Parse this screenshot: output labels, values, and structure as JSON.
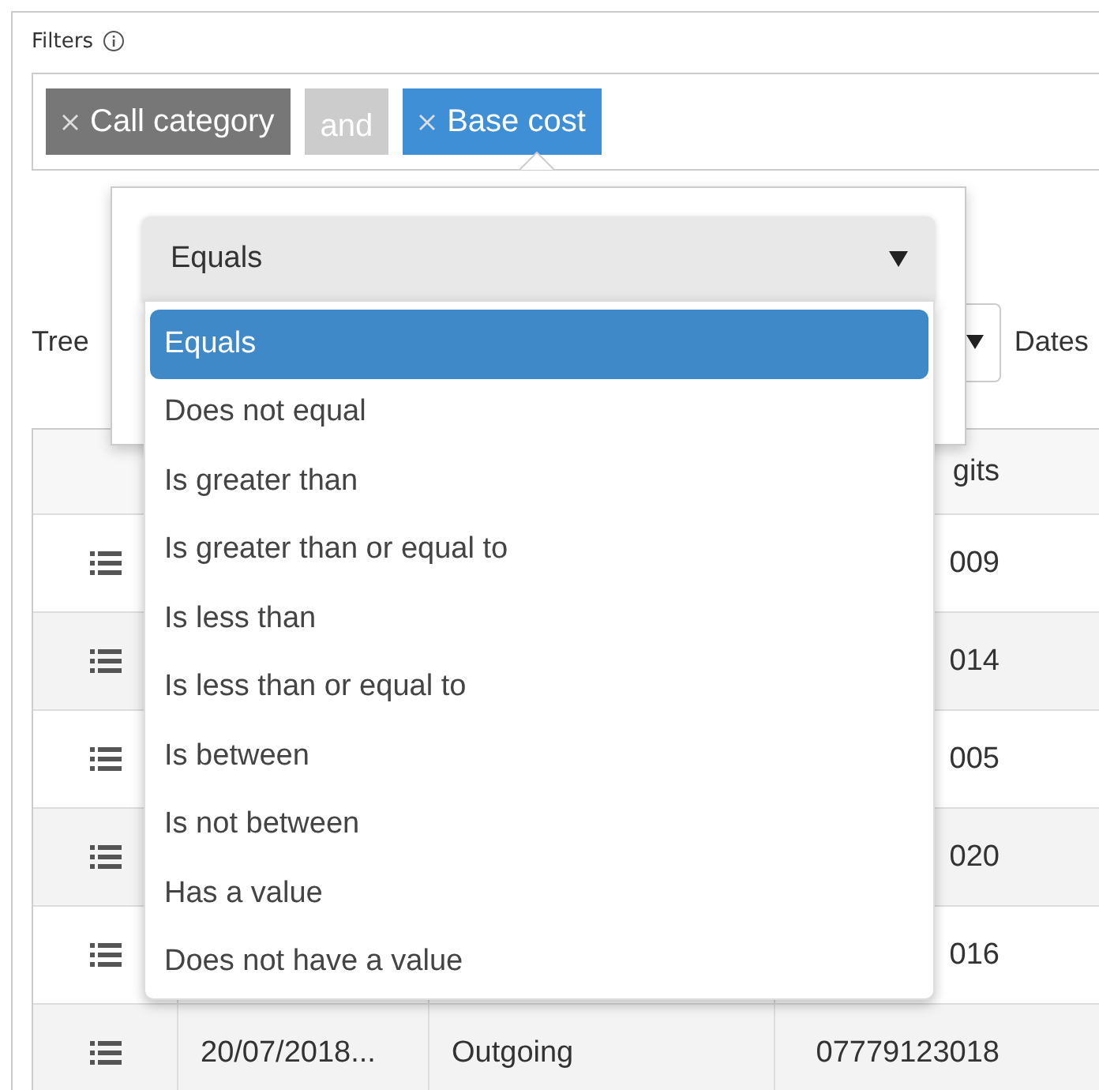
{
  "filters": {
    "label": "Filters",
    "chips": [
      {
        "kind": "field",
        "label": "Call category",
        "selected": false
      },
      {
        "kind": "operator",
        "label": "and"
      },
      {
        "kind": "field",
        "label": "Base cost",
        "selected": true
      }
    ]
  },
  "toolbar": {
    "label": "Tree",
    "next_label": "Dates"
  },
  "table": {
    "header": {
      "column_4": "gits"
    },
    "rows": [
      {
        "digits": "009"
      },
      {
        "digits": "014"
      },
      {
        "digits": "005"
      },
      {
        "digits": "020"
      },
      {
        "digits": "016"
      },
      {
        "date": "20/07/2018...",
        "direction": "Outgoing",
        "digits": "07779123018"
      }
    ]
  },
  "popover": {
    "select": {
      "value": "Equals"
    },
    "options": [
      {
        "label": "Equals",
        "selected": true
      },
      {
        "label": "Does not equal",
        "selected": false
      },
      {
        "label": "Is greater than",
        "selected": false
      },
      {
        "label": "Is greater than or equal to",
        "selected": false
      },
      {
        "label": "Is less than",
        "selected": false
      },
      {
        "label": "Is less than or equal to",
        "selected": false
      },
      {
        "label": "Is between",
        "selected": false
      },
      {
        "label": "Is not between",
        "selected": false
      },
      {
        "label": "Has a value",
        "selected": false
      },
      {
        "label": "Does not have a value",
        "selected": false
      }
    ]
  }
}
